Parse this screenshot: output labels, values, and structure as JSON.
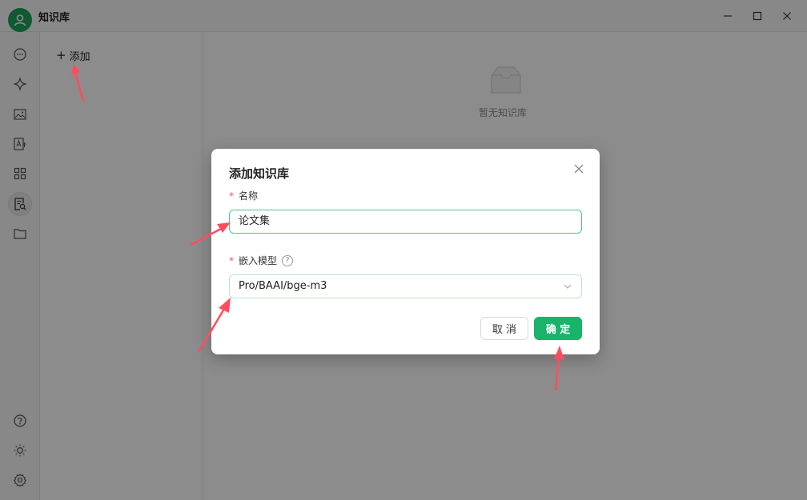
{
  "window": {
    "title": "知识库",
    "controls": [
      "minimize",
      "maximize",
      "close"
    ]
  },
  "sidebar": {
    "items": [
      {
        "icon": "chat-icon"
      },
      {
        "icon": "sparkle-icon"
      },
      {
        "icon": "image-icon"
      },
      {
        "icon": "translate-icon"
      },
      {
        "icon": "apps-grid-icon"
      },
      {
        "icon": "knowledge-base-icon",
        "active": true
      },
      {
        "icon": "folder-icon"
      }
    ],
    "bottom": [
      {
        "icon": "help-icon"
      },
      {
        "icon": "theme-sun-icon"
      },
      {
        "icon": "settings-gear-icon"
      }
    ]
  },
  "listpane": {
    "add_label": "添加"
  },
  "main": {
    "empty_text": "暂无知识库"
  },
  "dialog": {
    "title": "添加知识库",
    "name_label": "名称",
    "name_value": "论文集",
    "model_label": "嵌入模型",
    "model_value": "Pro/BAAI/bge-m3",
    "cancel_label": "取 消",
    "ok_label": "确 定"
  },
  "colors": {
    "accent": "#19b36a",
    "avatar": "#1ea35d",
    "required": "#ff4d4f",
    "annotation_arrow": "#ff4d5e"
  }
}
